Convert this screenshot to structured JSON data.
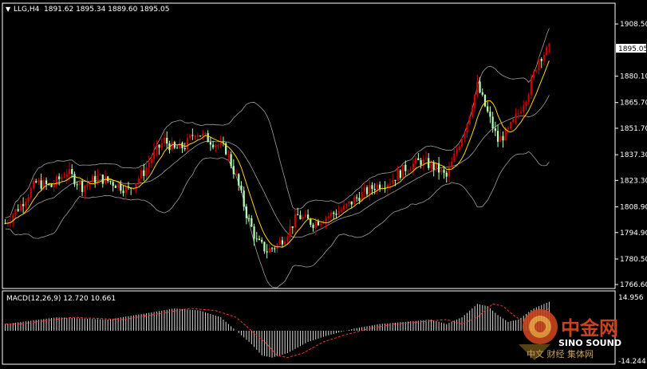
{
  "header": {
    "title": "LLG,H4",
    "ohlc": "1891.62 1895.34 1889.60 1895.05"
  },
  "macd": {
    "label": "MACD(12,26,9) 12.720 10.661",
    "scale_top": "14.956",
    "scale_bottom": "-14.244"
  },
  "current_price": "1895.05",
  "watermark": {
    "cn": "中金网",
    "en": "SINO SOUND",
    "sub": "中文  财经  集体网"
  },
  "colors": {
    "background": "#000000",
    "bull": "#cc0000",
    "bear": "#b4ffb4",
    "ma_fast": "#ffd700",
    "bands": "#a0a0a0",
    "macd_signal": "#ff3030",
    "axis": "#ffffff",
    "price_tag_bg": "#ffffff"
  },
  "chart_data": {
    "type": "candlestick",
    "title": "LLG,H4",
    "price_ylim": [
      1766.6,
      1912.0
    ],
    "price_ticks": [
      "1908.50",
      "1895.05",
      "1880.10",
      "1865.70",
      "1851.70",
      "1837.30",
      "1823.30",
      "1808.90",
      "1794.90",
      "1780.50",
      "1766.60"
    ],
    "macd_ylim": [
      -14.244,
      14.956
    ],
    "close_path": [
      [
        0,
        1800
      ],
      [
        6,
        1810
      ],
      [
        12,
        1822
      ],
      [
        18,
        1820
      ],
      [
        24,
        1828
      ],
      [
        30,
        1820
      ],
      [
        36,
        1825
      ],
      [
        42,
        1822
      ],
      [
        48,
        1818
      ],
      [
        54,
        1828
      ],
      [
        58,
        1838
      ],
      [
        62,
        1845
      ],
      [
        66,
        1840
      ],
      [
        70,
        1842
      ],
      [
        74,
        1850
      ],
      [
        80,
        1845
      ],
      [
        86,
        1840
      ],
      [
        90,
        1825
      ],
      [
        94,
        1805
      ],
      [
        98,
        1790
      ],
      [
        102,
        1785
      ],
      [
        106,
        1788
      ],
      [
        110,
        1795
      ],
      [
        114,
        1804
      ],
      [
        120,
        1800
      ],
      [
        126,
        1804
      ],
      [
        132,
        1808
      ],
      [
        138,
        1815
      ],
      [
        144,
        1820
      ],
      [
        150,
        1823
      ],
      [
        156,
        1830
      ],
      [
        162,
        1834
      ],
      [
        168,
        1830
      ],
      [
        172,
        1825
      ],
      [
        176,
        1840
      ],
      [
        180,
        1855
      ],
      [
        184,
        1875
      ],
      [
        188,
        1860
      ],
      [
        192,
        1845
      ],
      [
        196,
        1850
      ],
      [
        200,
        1860
      ],
      [
        204,
        1872
      ],
      [
        208,
        1890
      ],
      [
        212,
        1895
      ]
    ],
    "macd_path": [
      [
        0,
        3
      ],
      [
        20,
        6
      ],
      [
        40,
        5
      ],
      [
        56,
        8
      ],
      [
        66,
        10
      ],
      [
        76,
        9
      ],
      [
        84,
        6
      ],
      [
        90,
        0
      ],
      [
        96,
        -6
      ],
      [
        100,
        -11
      ],
      [
        104,
        -12
      ],
      [
        110,
        -10
      ],
      [
        118,
        -5
      ],
      [
        126,
        -2
      ],
      [
        136,
        1
      ],
      [
        146,
        3
      ],
      [
        156,
        4
      ],
      [
        166,
        5
      ],
      [
        172,
        3
      ],
      [
        178,
        6
      ],
      [
        184,
        12
      ],
      [
        188,
        11
      ],
      [
        192,
        7
      ],
      [
        196,
        4
      ],
      [
        200,
        5
      ],
      [
        206,
        10
      ],
      [
        212,
        13
      ]
    ]
  }
}
